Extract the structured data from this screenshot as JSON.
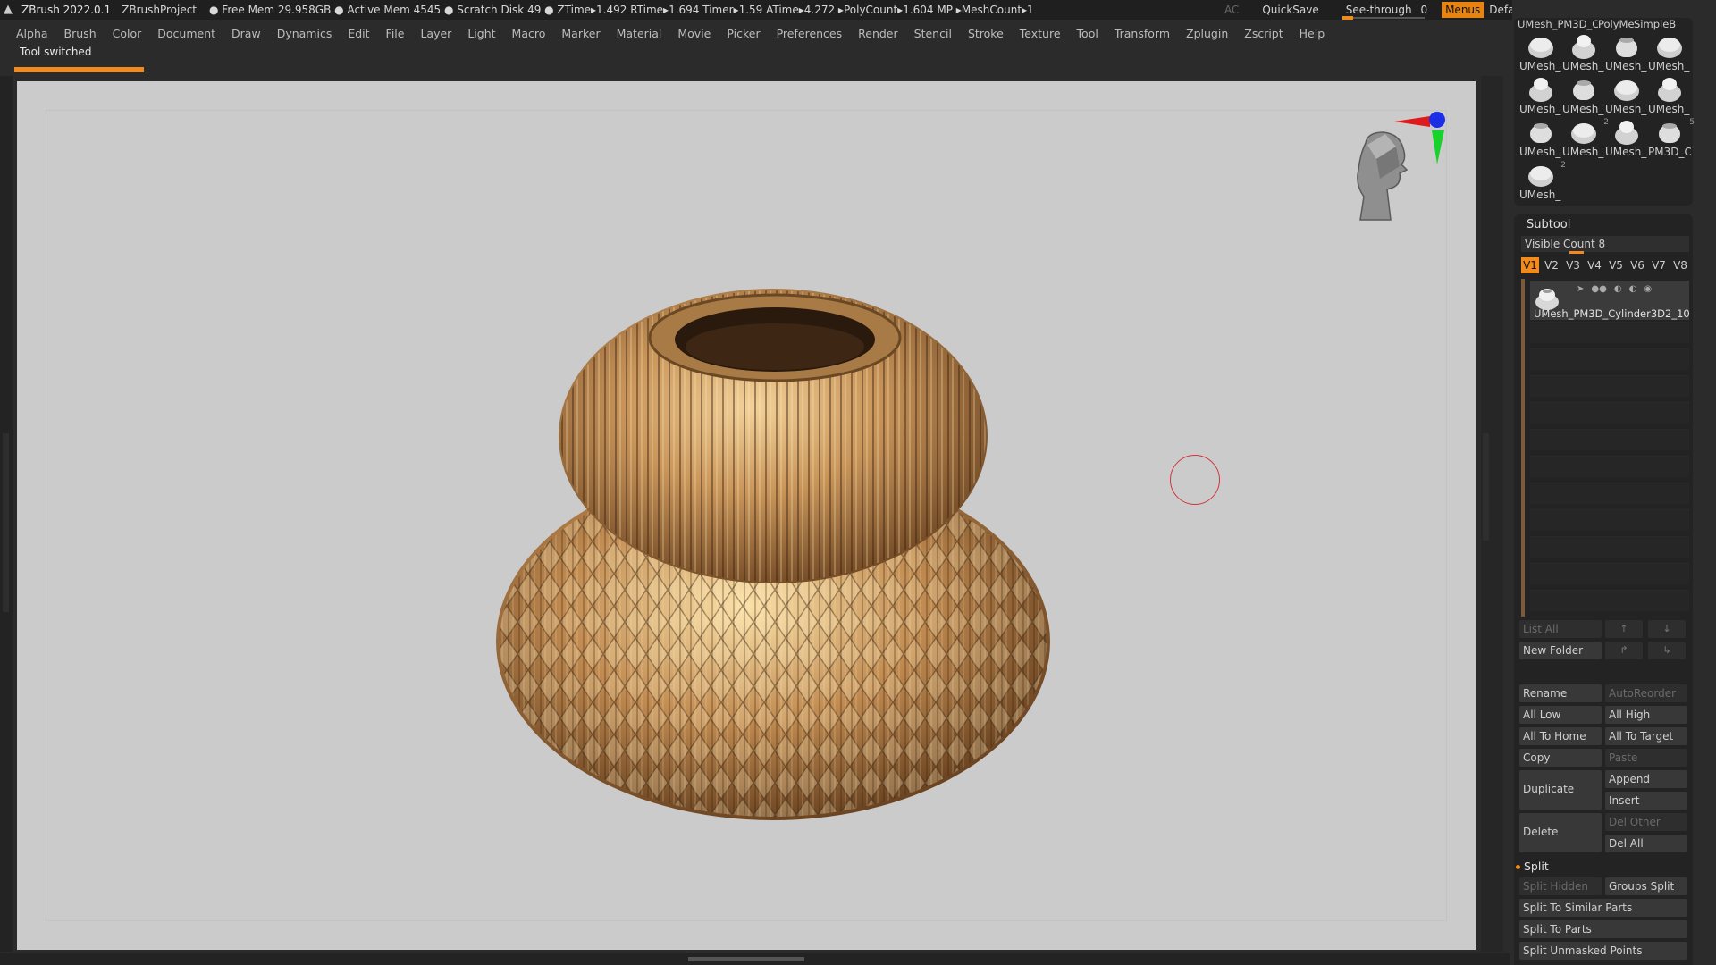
{
  "app": {
    "title": "ZBrush 2022.0.1",
    "project": "ZBrushProject",
    "stats": "● Free Mem 29.958GB ● Active Mem 4545 ● Scratch Disk 49 ●  ZTime▸1.492 RTime▸1.694 Timer▸1.59 ATime▸4.272 ▸PolyCount▸1.604 MP  ▸MeshCount▸1"
  },
  "titlebar_right": {
    "ac": "AC",
    "quicksave": "QuickSave",
    "see_through_label": "See-through",
    "see_through_value": "0",
    "menus": "Menus",
    "script": "DefaultZScript"
  },
  "menu": [
    "Alpha",
    "Brush",
    "Color",
    "Document",
    "Draw",
    "Dynamics",
    "Edit",
    "File",
    "Layer",
    "Light",
    "Macro",
    "Marker",
    "Material",
    "Movie",
    "Picker",
    "Preferences",
    "Render",
    "Stencil",
    "Stroke",
    "Texture",
    "Tool",
    "Transform",
    "Zplugin",
    "Zscript",
    "Help"
  ],
  "notice": "Tool switched",
  "tool_palette": {
    "top_labels": [
      "UMesh_PM3D_C",
      "PolyMes",
      "SimpleB"
    ],
    "rows": [
      [
        "UMesh_",
        "UMesh_",
        "UMesh_",
        "UMesh_"
      ],
      [
        "UMesh_",
        "UMesh_",
        "UMesh_",
        "UMesh_"
      ],
      [
        "UMesh_",
        "UMesh_",
        "UMesh_",
        "PM3D_C"
      ],
      [
        "UMesh_"
      ]
    ],
    "badges": {
      "r2c1": "2",
      "r2c3": "5",
      "r3c0": "2"
    }
  },
  "subtool": {
    "title": "Subtool",
    "visible_count": "Visible Count 8",
    "versions": [
      "V1",
      "V2",
      "V3",
      "V4",
      "V5",
      "V6",
      "V7",
      "V8"
    ],
    "active_version": "V1",
    "item_name": "UMesh_PM3D_Cylinder3D2_10",
    "list_all": "List All",
    "new_folder": "New Folder",
    "rename": "Rename",
    "auto_reorder": "AutoReorder",
    "all_low": "All Low",
    "all_high": "All High",
    "all_to_home": "All To Home",
    "all_to_target": "All To Target",
    "copy": "Copy",
    "paste": "Paste",
    "duplicate": "Duplicate",
    "append": "Append",
    "insert": "Insert",
    "delete": "Delete",
    "del_other": "Del Other",
    "del_all": "Del All",
    "split_title": "Split",
    "split_hidden": "Split Hidden",
    "groups_split": "Groups Split",
    "split_similar": "Split To Similar Parts",
    "split_parts": "Split To Parts",
    "split_unmasked": "Split Unmasked Points"
  },
  "colors": {
    "accent": "#f28b1d",
    "canvas": "#cbcbcb",
    "vase": "#b88550"
  }
}
